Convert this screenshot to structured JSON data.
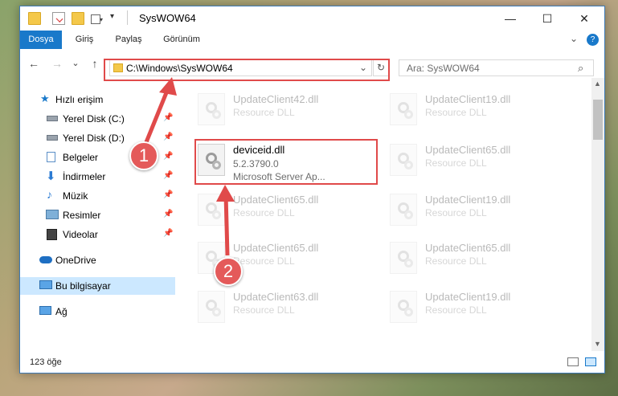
{
  "window": {
    "title": "SysWOW64",
    "minimize_glyph": "—",
    "maximize_glyph": "☐",
    "close_glyph": "✕",
    "help_glyph": "?"
  },
  "ribbon": {
    "tabs": [
      {
        "label": "Dosya",
        "active": true
      },
      {
        "label": "Giriş"
      },
      {
        "label": "Paylaş"
      },
      {
        "label": "Görünüm"
      }
    ],
    "expand_glyph": "⌄"
  },
  "nav": {
    "back_glyph": "←",
    "forward_glyph": "→",
    "recent_glyph": "⌄",
    "up_glyph": "↑",
    "address": "C:\\Windows\\SysWOW64",
    "address_dropdown_glyph": "⌄",
    "refresh_glyph": "↻",
    "search_placeholder": "Ara: SysWOW64",
    "search_glyph": "⌕"
  },
  "sidebar": {
    "items": [
      {
        "label": "Hızlı erişim",
        "icon": "star-icon"
      },
      {
        "label": "Yerel Disk (C:)",
        "icon": "drive-icon",
        "pinned": true
      },
      {
        "label": "Yerel Disk (D:)",
        "icon": "drive-icon",
        "pinned": true
      },
      {
        "label": "Belgeler",
        "icon": "documents-icon",
        "pinned": true
      },
      {
        "label": "İndirmeler",
        "icon": "downloads-icon",
        "pinned": true
      },
      {
        "label": "Müzik",
        "icon": "music-icon",
        "pinned": true
      },
      {
        "label": "Resimler",
        "icon": "pictures-icon",
        "pinned": true
      },
      {
        "label": "Videolar",
        "icon": "videos-icon",
        "pinned": true
      },
      {
        "label": "OneDrive",
        "icon": "onedrive-icon"
      },
      {
        "label": "Bu bilgisayar",
        "icon": "computer-icon",
        "selected": true
      },
      {
        "label": "Ağ",
        "icon": "network-icon"
      }
    ],
    "pin_glyph": "📌"
  },
  "files": [
    {
      "name": "UpdateClient42.dll",
      "line1": "Resource DLL",
      "line2": "",
      "faded": true
    },
    {
      "name": "UpdateClient19.dll",
      "line1": "Resource DLL",
      "line2": "",
      "faded": true
    },
    {
      "name": "deviceid.dll",
      "line1": "5.2.3790.0",
      "line2": "Microsoft Server Ap...",
      "faded": false
    },
    {
      "name": "UpdateClient65.dll",
      "line1": "Resource DLL",
      "line2": "",
      "faded": true
    },
    {
      "name": "UpdateClient65.dll",
      "line1": "Resource DLL",
      "line2": "",
      "faded": true
    },
    {
      "name": "UpdateClient19.dll",
      "line1": "Resource DLL",
      "line2": "",
      "faded": true
    },
    {
      "name": "UpdateClient65.dll",
      "line1": "Resource DLL",
      "line2": "",
      "faded": true
    },
    {
      "name": "UpdateClient65.dll",
      "line1": "Resource DLL",
      "line2": "",
      "faded": true
    },
    {
      "name": "UpdateClient63.dll",
      "line1": "Resource DLL",
      "line2": "",
      "faded": true
    },
    {
      "name": "UpdateClient19.dll",
      "line1": "Resource DLL",
      "line2": "",
      "faded": true
    }
  ],
  "status": {
    "item_count": "123 öğe"
  },
  "annotations": {
    "badge1": "1",
    "badge2": "2",
    "color": "#e04a4a"
  }
}
